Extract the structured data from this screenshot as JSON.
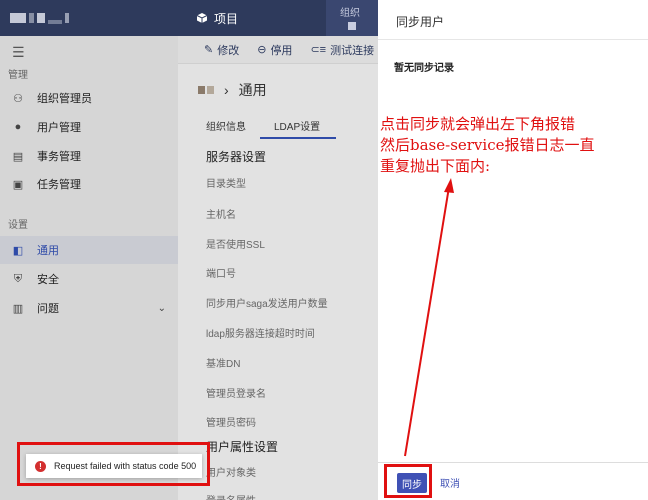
{
  "topbar": {
    "project_icon": "cube-icon",
    "project_label": "项目",
    "org_label": "组织"
  },
  "sidebar": {
    "menu_icon": "hamburger-icon",
    "section_manage": "管理",
    "section_settings": "设置",
    "items": [
      {
        "label": "组织管理员",
        "icon": "people-icon"
      },
      {
        "label": "用户管理",
        "icon": "user-icon"
      },
      {
        "label": "事务管理",
        "icon": "document-icon"
      },
      {
        "label": "任务管理",
        "icon": "task-icon"
      },
      {
        "label": "通用",
        "icon": "general-icon",
        "active": true
      },
      {
        "label": "安全",
        "icon": "shield-icon"
      },
      {
        "label": "问题",
        "icon": "clipboard-icon"
      }
    ]
  },
  "toolbar": {
    "edit_label": "修改",
    "disable_label": "停用",
    "test_label": "测试连接"
  },
  "breadcrumb": {
    "current": "通用"
  },
  "tabs": [
    {
      "label": "组织信息",
      "active": false
    },
    {
      "label": "LDAP设置",
      "active": true
    }
  ],
  "server_section": {
    "title": "服务器设置",
    "fields": [
      "目录类型",
      "主机名",
      "是否使用SSL",
      "端口号",
      "同步用户saga发送用户数量",
      "ldap服务器连接超时时间",
      "基准DN",
      "管理员登录名",
      "管理员密码"
    ]
  },
  "user_section": {
    "title": "用户属性设置",
    "fields": [
      "用户对象类",
      "登录名属性"
    ]
  },
  "panel": {
    "title": "同步用户",
    "empty_text": "暂无同步记录",
    "sync_label": "同步",
    "cancel_label": "取消"
  },
  "annotation": {
    "lines": [
      "点击同步就会弹出左下角报错",
      "然后base-service报错日志一直",
      "重复抛出下面内:"
    ]
  },
  "toast": {
    "message": "Request failed with status code 500",
    "icon": "error-icon"
  },
  "colors": {
    "topbar": "#2e3a5c",
    "primary": "#3f51b5",
    "annotation_red": "#e01010",
    "error": "#d32f2f"
  }
}
